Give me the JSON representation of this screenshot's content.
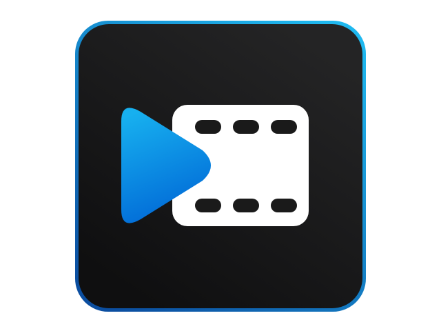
{
  "icon": {
    "type": "app-icon",
    "symbol": "play-button-with-film-strip",
    "colors": {
      "background": "#ffffff",
      "tile_dark": "#1c1c1d",
      "tile_darker": "#121213",
      "border_top": "#1fb8ef",
      "border_bottom": "#0b4ea0",
      "play_top": "#17b0ef",
      "play_bottom": "#0067d6",
      "film": "#ffffff",
      "film_holes": "#1a1a1a"
    }
  }
}
